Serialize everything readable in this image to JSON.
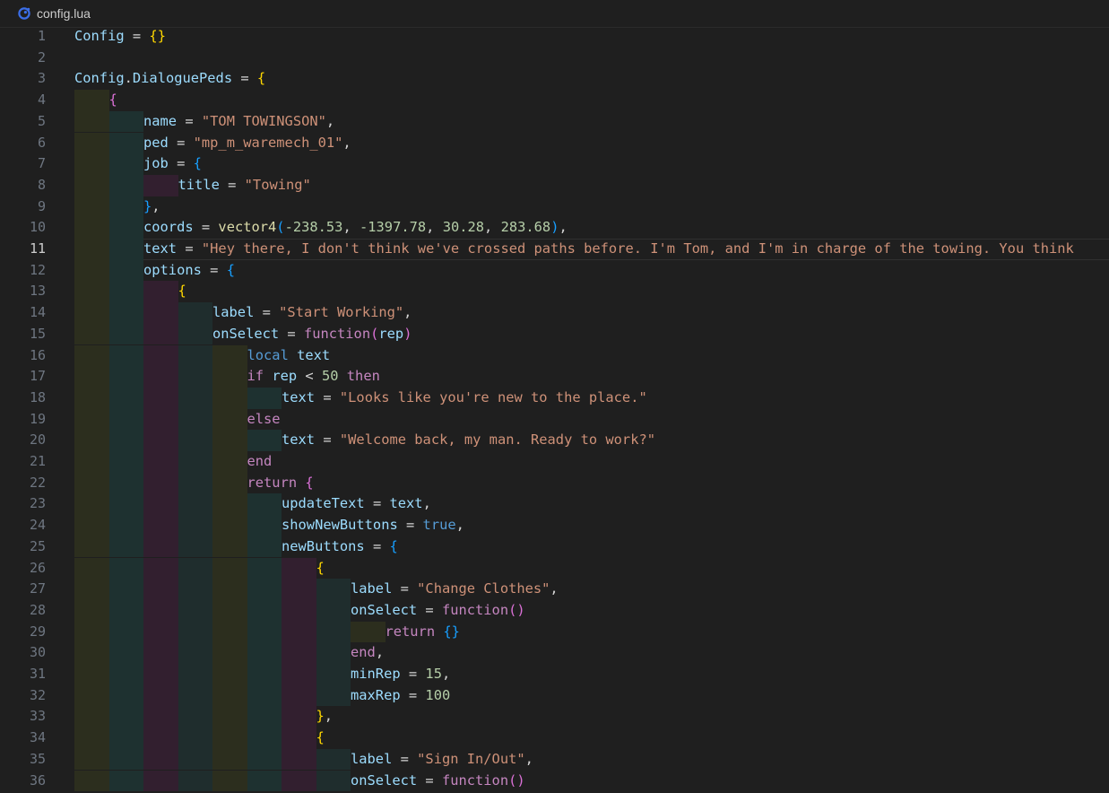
{
  "tab": {
    "filename": "config.lua",
    "icon": "lua-file-icon"
  },
  "editor": {
    "current_line": 11,
    "lines": [
      {
        "n": 1,
        "i": 0,
        "t": [
          [
            "Config",
            "var"
          ],
          [
            " = ",
            "op"
          ],
          [
            "{}",
            "b1"
          ]
        ]
      },
      {
        "n": 2,
        "i": 0,
        "t": []
      },
      {
        "n": 3,
        "i": 0,
        "t": [
          [
            "Config",
            "var"
          ],
          [
            ".",
            "op"
          ],
          [
            "DialoguePeds",
            "var"
          ],
          [
            " = ",
            "op"
          ],
          [
            "{",
            "b1"
          ]
        ]
      },
      {
        "n": 4,
        "i": 1,
        "t": [
          [
            "{",
            "b2"
          ]
        ]
      },
      {
        "n": 5,
        "i": 2,
        "t": [
          [
            "name",
            "var"
          ],
          [
            " = ",
            "op"
          ],
          [
            "\"TOM TOWINGSON\"",
            "str"
          ],
          [
            ",",
            "op"
          ]
        ]
      },
      {
        "n": 6,
        "i": 2,
        "t": [
          [
            "ped",
            "var"
          ],
          [
            " = ",
            "op"
          ],
          [
            "\"mp_m_waremech_01\"",
            "str"
          ],
          [
            ",",
            "op"
          ]
        ]
      },
      {
        "n": 7,
        "i": 2,
        "t": [
          [
            "job",
            "var"
          ],
          [
            " = ",
            "op"
          ],
          [
            "{",
            "b3"
          ]
        ]
      },
      {
        "n": 8,
        "i": 3,
        "t": [
          [
            "title",
            "var"
          ],
          [
            " = ",
            "op"
          ],
          [
            "\"Towing\"",
            "str"
          ]
        ]
      },
      {
        "n": 9,
        "i": 2,
        "t": [
          [
            "}",
            "b3"
          ],
          [
            ",",
            "op"
          ]
        ]
      },
      {
        "n": 10,
        "i": 2,
        "t": [
          [
            "coords",
            "var"
          ],
          [
            " = ",
            "op"
          ],
          [
            "vector4",
            "fn"
          ],
          [
            "(",
            "b3"
          ],
          [
            "-238.53",
            "num"
          ],
          [
            ", ",
            "op"
          ],
          [
            "-1397.78",
            "num"
          ],
          [
            ", ",
            "op"
          ],
          [
            "30.28",
            "num"
          ],
          [
            ", ",
            "op"
          ],
          [
            "283.68",
            "num"
          ],
          [
            ")",
            "b3"
          ],
          [
            ",",
            "op"
          ]
        ]
      },
      {
        "n": 11,
        "i": 2,
        "t": [
          [
            "text",
            "var"
          ],
          [
            " = ",
            "op"
          ],
          [
            "\"Hey there, I don't think we've crossed paths before. I'm Tom, and I'm in charge of the towing. You think",
            "str"
          ]
        ]
      },
      {
        "n": 12,
        "i": 2,
        "t": [
          [
            "options",
            "var"
          ],
          [
            " = ",
            "op"
          ],
          [
            "{",
            "b3"
          ]
        ]
      },
      {
        "n": 13,
        "i": 3,
        "t": [
          [
            "{",
            "b1"
          ]
        ]
      },
      {
        "n": 14,
        "i": 4,
        "t": [
          [
            "label",
            "var"
          ],
          [
            " = ",
            "op"
          ],
          [
            "\"Start Working\"",
            "str"
          ],
          [
            ",",
            "op"
          ]
        ]
      },
      {
        "n": 15,
        "i": 4,
        "t": [
          [
            "onSelect",
            "var"
          ],
          [
            " = ",
            "op"
          ],
          [
            "function",
            "kw"
          ],
          [
            "(",
            "b2"
          ],
          [
            "rep",
            "var"
          ],
          [
            ")",
            "b2"
          ]
        ]
      },
      {
        "n": 16,
        "i": 5,
        "t": [
          [
            "local",
            "decl"
          ],
          [
            " ",
            "op"
          ],
          [
            "text",
            "var"
          ]
        ]
      },
      {
        "n": 17,
        "i": 5,
        "t": [
          [
            "if",
            "kw"
          ],
          [
            " ",
            "op"
          ],
          [
            "rep",
            "var"
          ],
          [
            " < ",
            "op"
          ],
          [
            "50",
            "num"
          ],
          [
            " ",
            "op"
          ],
          [
            "then",
            "kw"
          ]
        ]
      },
      {
        "n": 18,
        "i": 6,
        "t": [
          [
            "text",
            "var"
          ],
          [
            " = ",
            "op"
          ],
          [
            "\"Looks like you're new to the place.\"",
            "str"
          ]
        ]
      },
      {
        "n": 19,
        "i": 5,
        "t": [
          [
            "else",
            "kw"
          ]
        ]
      },
      {
        "n": 20,
        "i": 6,
        "t": [
          [
            "text",
            "var"
          ],
          [
            " = ",
            "op"
          ],
          [
            "\"Welcome back, my man. Ready to work?\"",
            "str"
          ]
        ]
      },
      {
        "n": 21,
        "i": 5,
        "t": [
          [
            "end",
            "kw"
          ]
        ]
      },
      {
        "n": 22,
        "i": 5,
        "t": [
          [
            "return",
            "kw"
          ],
          [
            " ",
            "op"
          ],
          [
            "{",
            "b2"
          ]
        ]
      },
      {
        "n": 23,
        "i": 6,
        "t": [
          [
            "updateText",
            "var"
          ],
          [
            " = ",
            "op"
          ],
          [
            "text",
            "var"
          ],
          [
            ",",
            "op"
          ]
        ]
      },
      {
        "n": 24,
        "i": 6,
        "t": [
          [
            "showNewButtons",
            "var"
          ],
          [
            " = ",
            "op"
          ],
          [
            "true",
            "decl"
          ],
          [
            ",",
            "op"
          ]
        ]
      },
      {
        "n": 25,
        "i": 6,
        "t": [
          [
            "newButtons",
            "var"
          ],
          [
            " = ",
            "op"
          ],
          [
            "{",
            "b3"
          ]
        ]
      },
      {
        "n": 26,
        "i": 7,
        "t": [
          [
            "{",
            "b1"
          ]
        ]
      },
      {
        "n": 27,
        "i": 8,
        "t": [
          [
            "label",
            "var"
          ],
          [
            " = ",
            "op"
          ],
          [
            "\"Change Clothes\"",
            "str"
          ],
          [
            ",",
            "op"
          ]
        ]
      },
      {
        "n": 28,
        "i": 8,
        "t": [
          [
            "onSelect",
            "var"
          ],
          [
            " = ",
            "op"
          ],
          [
            "function",
            "kw"
          ],
          [
            "()",
            "b2"
          ]
        ]
      },
      {
        "n": 29,
        "i": 9,
        "t": [
          [
            "return",
            "kw"
          ],
          [
            " ",
            "op"
          ],
          [
            "{}",
            "b3"
          ]
        ]
      },
      {
        "n": 30,
        "i": 8,
        "t": [
          [
            "end",
            "kw"
          ],
          [
            ",",
            "op"
          ]
        ]
      },
      {
        "n": 31,
        "i": 8,
        "t": [
          [
            "minRep",
            "var"
          ],
          [
            " = ",
            "op"
          ],
          [
            "15",
            "num"
          ],
          [
            ",",
            "op"
          ]
        ]
      },
      {
        "n": 32,
        "i": 8,
        "t": [
          [
            "maxRep",
            "var"
          ],
          [
            " = ",
            "op"
          ],
          [
            "100",
            "num"
          ]
        ]
      },
      {
        "n": 33,
        "i": 7,
        "t": [
          [
            "}",
            "b1"
          ],
          [
            ",",
            "op"
          ]
        ]
      },
      {
        "n": 34,
        "i": 7,
        "t": [
          [
            "{",
            "b1"
          ]
        ]
      },
      {
        "n": 35,
        "i": 8,
        "t": [
          [
            "label",
            "var"
          ],
          [
            " = ",
            "op"
          ],
          [
            "\"Sign In/Out\"",
            "str"
          ],
          [
            ",",
            "op"
          ]
        ]
      },
      {
        "n": 36,
        "i": 8,
        "t": [
          [
            "onSelect",
            "var"
          ],
          [
            " = ",
            "op"
          ],
          [
            "function",
            "kw"
          ],
          [
            "()",
            "b2"
          ]
        ]
      }
    ]
  },
  "indent_guide_colors": [
    "#2c2e1e",
    "#1e3130",
    "#321f2f",
    "#1f2d2d",
    "#2c2e1e",
    "#1e3130",
    "#321f2f",
    "#1f2d2d",
    "#2c2e1e"
  ]
}
